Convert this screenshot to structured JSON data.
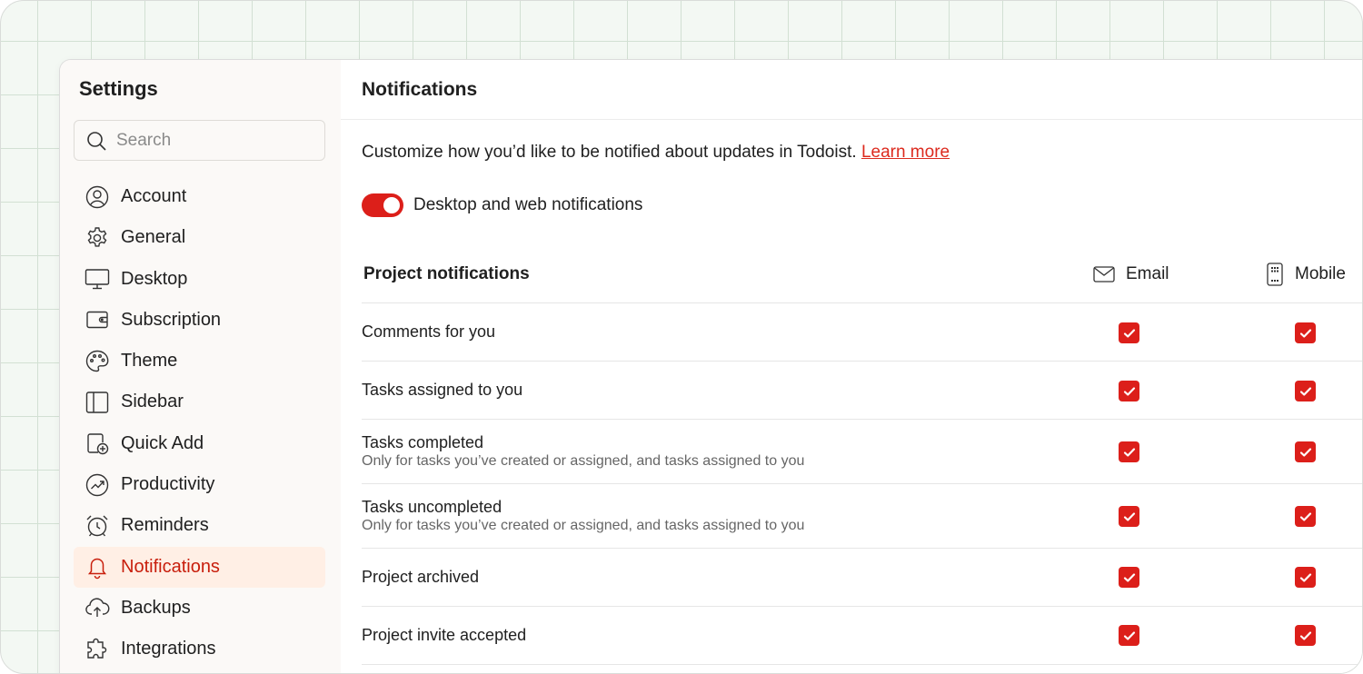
{
  "sidebar": {
    "title": "Settings",
    "search_placeholder": "Search",
    "items": [
      {
        "label": "Account",
        "icon": "account-circle-icon"
      },
      {
        "label": "General",
        "icon": "gear-icon"
      },
      {
        "label": "Desktop",
        "icon": "monitor-icon"
      },
      {
        "label": "Subscription",
        "icon": "wallet-icon"
      },
      {
        "label": "Theme",
        "icon": "palette-icon"
      },
      {
        "label": "Sidebar",
        "icon": "sidebar-icon"
      },
      {
        "label": "Quick Add",
        "icon": "quick-add-icon"
      },
      {
        "label": "Productivity",
        "icon": "trend-icon"
      },
      {
        "label": "Reminders",
        "icon": "alarm-clock-icon"
      },
      {
        "label": "Notifications",
        "icon": "bell-icon",
        "active": true
      },
      {
        "label": "Backups",
        "icon": "cloud-upload-icon"
      },
      {
        "label": "Integrations",
        "icon": "puzzle-icon"
      }
    ]
  },
  "main": {
    "title": "Notifications",
    "intro_text": "Customize how you’d like to be notified about updates in Todoist. ",
    "learn_more": "Learn more",
    "toggle_label": "Desktop and web notifications",
    "toggle_on": true,
    "table": {
      "title": "Project notifications",
      "col_email": "Email",
      "col_mobile": "Mobile",
      "rows": [
        {
          "name": "Comments for you",
          "desc": "",
          "email": true,
          "mobile": true
        },
        {
          "name": "Tasks assigned to you",
          "desc": "",
          "email": true,
          "mobile": true
        },
        {
          "name": "Tasks completed",
          "desc": "Only for tasks you’ve created or assigned, and tasks assigned to you",
          "email": true,
          "mobile": true
        },
        {
          "name": "Tasks uncompleted",
          "desc": "Only for tasks you’ve created or assigned, and tasks assigned to you",
          "email": true,
          "mobile": true
        },
        {
          "name": "Project archived",
          "desc": "",
          "email": true,
          "mobile": true
        },
        {
          "name": "Project invite accepted",
          "desc": "",
          "email": true,
          "mobile": true
        }
      ]
    }
  },
  "colors": {
    "accent": "#dc1f1a",
    "active_bg": "#ffefe5",
    "active_text": "#c81e0c"
  }
}
